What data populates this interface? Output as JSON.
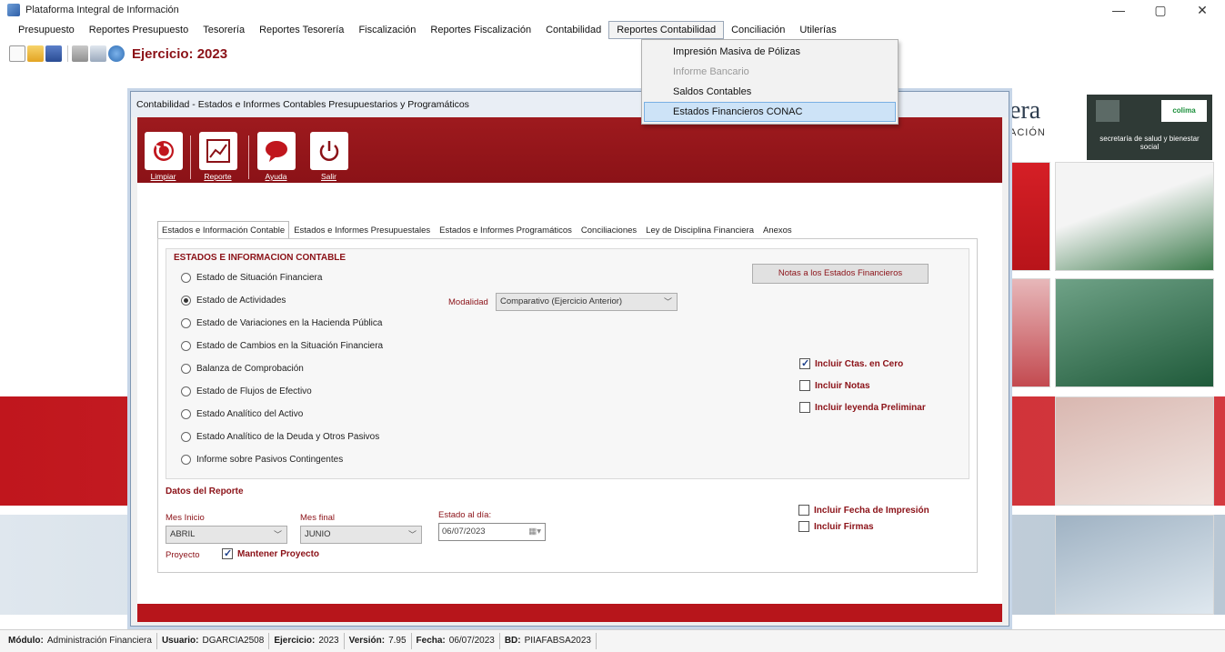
{
  "window": {
    "title": "Plataforma Integral de Información",
    "minimize": "—",
    "maximize": "▢",
    "close": "✕"
  },
  "menu": {
    "items": [
      "Presupuesto",
      "Reportes Presupuesto",
      "Tesorería",
      "Reportes Tesorería",
      "Fiscalización",
      "Reportes Fiscalización",
      "Contabilidad",
      "Reportes Contabilidad",
      "Conciliación",
      "Utilerías"
    ]
  },
  "toolbar": {
    "ejercicio": "Ejercicio: 2023"
  },
  "dropdown": {
    "items": [
      {
        "label": "Impresión Masiva de Pólizas"
      },
      {
        "label": "Informe Bancario"
      },
      {
        "label": "Saldos Contables"
      },
      {
        "label": "Estados Financieros CONAC"
      }
    ]
  },
  "background": {
    "brand": "era",
    "subtitle": "ACIÓN",
    "logo_text": "secretaría de salud y bienestar social",
    "logo_brand": "colima"
  },
  "dialog": {
    "title": "Contabilidad - Estados e Informes Contables Presupuestarios y Programáticos",
    "tools": {
      "limpiar": "Limpiar",
      "reporte": "Reporte",
      "ayuda": "Ayuda",
      "salir": "Salir"
    },
    "tabs": [
      "Estados e Información Contable",
      "Estados e Informes Presupuestales",
      "Estados e Informes Programáticos",
      "Conciliaciones",
      "Ley de Disciplina Financiera",
      "Anexos"
    ],
    "section_title": "ESTADOS E INFORMACION CONTABLE",
    "options": [
      "Estado de Situación Financiera",
      "Estado de Actividades",
      "Estado de Variaciones en la Hacienda Pública",
      "Estado de Cambios en la Situación Financiera",
      "Balanza de Comprobación",
      "Estado de Flujos de Efectivo",
      "Estado Analítico del Activo",
      "Estado Analítico de la Deuda y Otros Pasivos",
      "Informe sobre Pasivos Contingentes"
    ],
    "notas_button": "Notas a los Estados Financieros",
    "modalidad_label": "Modalidad",
    "modalidad_value": "Comparativo (Ejercicio Anterior)",
    "checks": {
      "ctas_cero": "Incluir Ctas. en Cero",
      "notas": "Incluir Notas",
      "leyenda": "Incluir leyenda Preliminar",
      "fecha_impresion": "Incluir Fecha de Impresión",
      "firmas": "Incluir Firmas",
      "mantener_proyecto": "Mantener Proyecto"
    },
    "report_section_title": "Datos del Reporte",
    "mes_inicio_label": "Mes Inicio",
    "mes_inicio_value": "ABRIL",
    "mes_final_label": "Mes final",
    "mes_final_value": "JUNIO",
    "estado_label": "Estado al día:",
    "estado_value": "06/07/2023",
    "proyecto_label": "Proyecto",
    "proyecto_value": ""
  },
  "status": {
    "modulo_label": "Módulo:",
    "modulo": "Administración Financiera",
    "usuario_label": "Usuario:",
    "usuario": "DGARCIA2508",
    "ejercicio_label": "Ejercicio:",
    "ejercicio": "2023",
    "version_label": "Versión:",
    "version": "7.95",
    "fecha_label": "Fecha:",
    "fecha": "06/07/2023",
    "bd_label": "BD:",
    "bd": "PIIAFABSA2023"
  },
  "colors": {
    "accent_red": "#8b1117",
    "toolbar_red": "#9e1a1e",
    "selection_blue": "#cde3f7"
  }
}
